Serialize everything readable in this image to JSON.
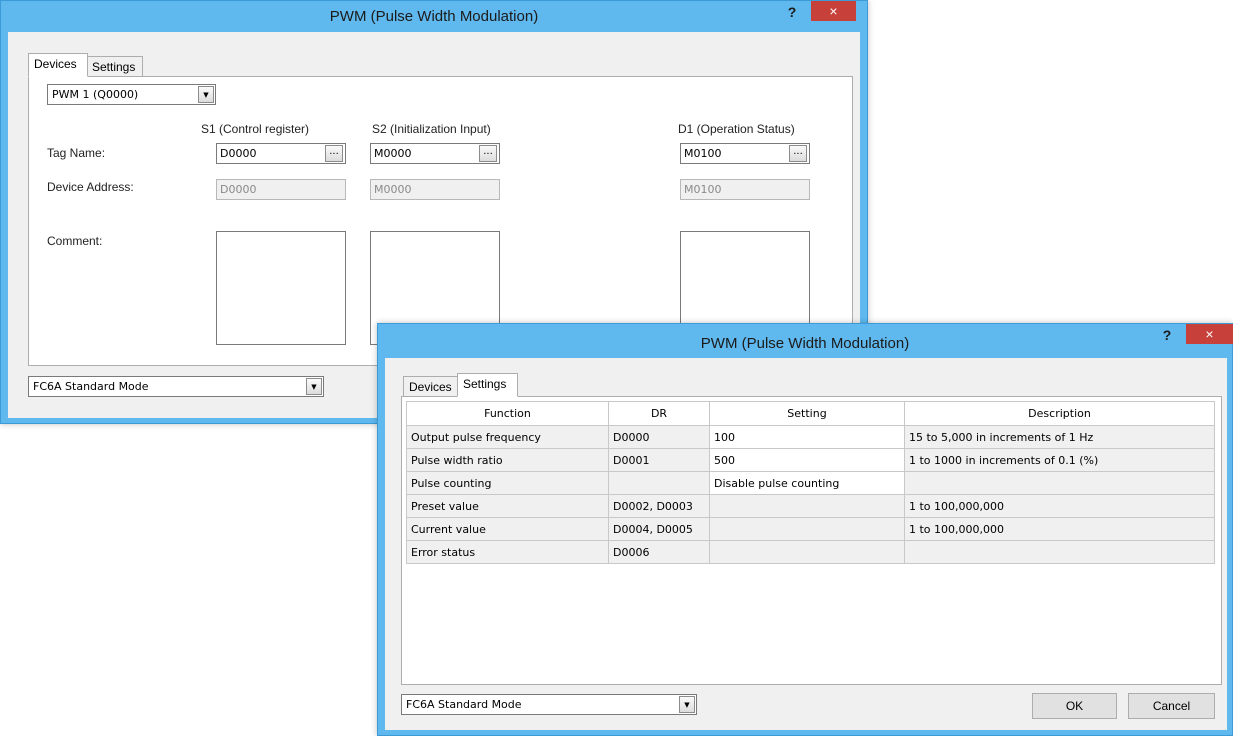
{
  "back_window": {
    "title": "PWM (Pulse Width Modulation)",
    "help_label": "?",
    "close_label": "×",
    "tabs": [
      {
        "label": "Devices"
      },
      {
        "label": "Settings"
      }
    ],
    "channel_select": "PWM 1 (Q0000)",
    "columns": {
      "s1": "S1 (Control register)",
      "s2": "S2 (Initialization Input)",
      "d1": "D1 (Operation Status)"
    },
    "row_labels": {
      "tag_name": "Tag Name:",
      "device_address": "Device Address:",
      "comment": "Comment:"
    },
    "tag_names": {
      "s1": "D0000",
      "s2": "M0000",
      "d1": "M0100"
    },
    "device_addresses": {
      "s1": "D0000",
      "s2": "M0000",
      "d1": "M0100"
    },
    "browse_label": "...",
    "mode_select": "FC6A Standard Mode"
  },
  "front_window": {
    "title": "PWM (Pulse Width Modulation)",
    "help_label": "?",
    "close_label": "×",
    "tabs": [
      {
        "label": "Devices"
      },
      {
        "label": "Settings"
      }
    ],
    "table": {
      "headers": [
        "Function",
        "DR",
        "Setting",
        "Description"
      ],
      "rows": [
        {
          "function": "Output pulse frequency",
          "dr": "D0000",
          "setting": "100",
          "description": "15 to 5,000 in increments of 1 Hz"
        },
        {
          "function": "Pulse width ratio",
          "dr": "D0001",
          "setting": "500",
          "description": "1 to 1000 in increments of 0.1 (%)"
        },
        {
          "function": "Pulse counting",
          "dr": "",
          "setting": "Disable pulse counting",
          "description": ""
        },
        {
          "function": "Preset value",
          "dr": "D0002, D0003",
          "setting": "",
          "description": "1 to 100,000,000"
        },
        {
          "function": "Current value",
          "dr": "D0004, D0005",
          "setting": "",
          "description": "1 to 100,000,000"
        },
        {
          "function": "Error status",
          "dr": "D0006",
          "setting": "",
          "description": ""
        }
      ]
    },
    "mode_select": "FC6A Standard Mode",
    "ok_label": "OK",
    "cancel_label": "Cancel"
  }
}
